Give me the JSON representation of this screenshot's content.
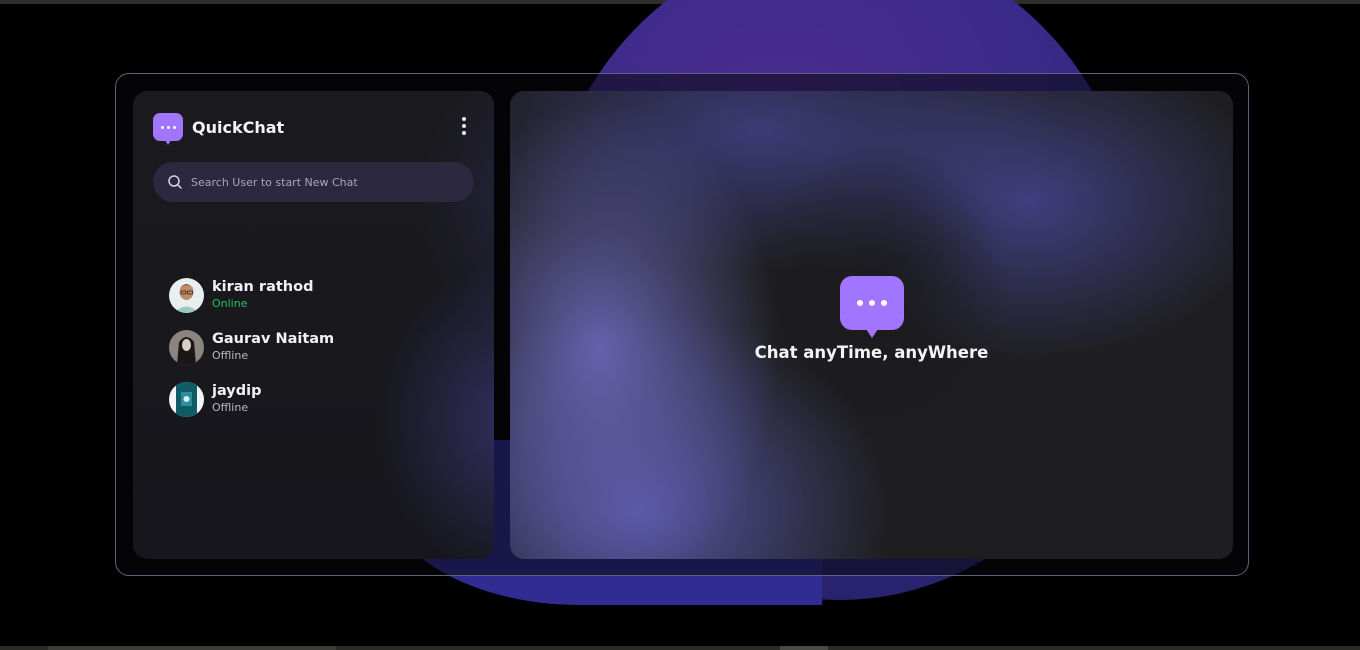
{
  "app": {
    "name": "QuickChat",
    "accent_color": "#a275ff"
  },
  "sidebar": {
    "menu_icon": "more-vertical-icon",
    "search": {
      "icon": "search-icon",
      "placeholder": "Search User to start New Chat",
      "value": ""
    },
    "users": [
      {
        "name": "kiran rathod",
        "status": "Online",
        "status_color": "#22c55e"
      },
      {
        "name": "Gaurav Naitam",
        "status": "Offline",
        "status_color": "#b9b9bf"
      },
      {
        "name": "jaydip",
        "status": "Offline",
        "status_color": "#b9b9bf"
      }
    ]
  },
  "chat_panel": {
    "icon": "chat-bubble-icon",
    "welcome_text": "Chat anyTime, anyWhere"
  }
}
